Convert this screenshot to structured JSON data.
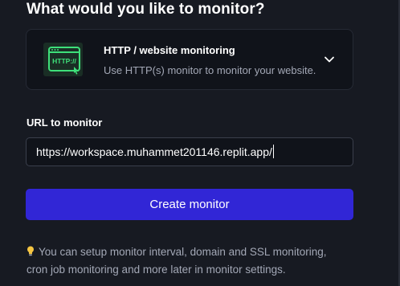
{
  "heading": "What would you like to monitor?",
  "monitor_type": {
    "icon": "http-browser-icon",
    "icon_text": "HTTP://",
    "title": "HTTP / website monitoring",
    "description": "Use HTTP(s) monitor to monitor your website."
  },
  "url_field": {
    "label": "URL to monitor",
    "value": "https://workspace.muhammet201146.replit.app/"
  },
  "create_button": {
    "label": "Create monitor"
  },
  "hint": {
    "icon": "lightbulb-icon",
    "line1": "You can setup monitor interval, domain and SSL monitoring,",
    "line2": "cron job monitoring and more later in monitor settings."
  },
  "colors": {
    "background": "#171a22",
    "card": "#10131a",
    "accent": "#3126d6",
    "icon_green": "#3ee07a",
    "muted_text": "#a3a8b6"
  }
}
